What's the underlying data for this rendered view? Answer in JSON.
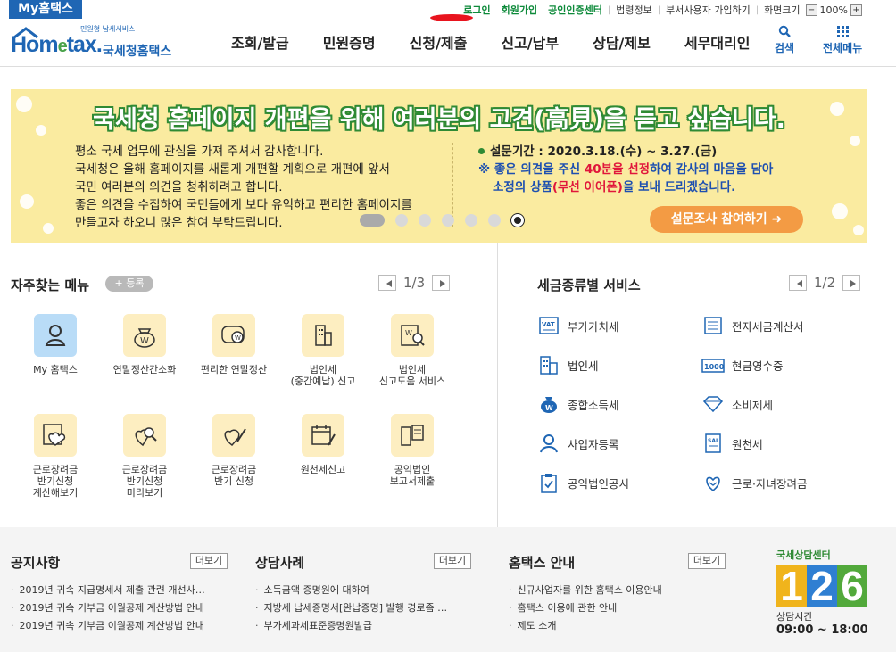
{
  "top": {
    "my_tab": "My홈택스",
    "links": [
      "로그인",
      "회원가입",
      "공인인증센터",
      "법령정보",
      "부서사용자 가입하기",
      "화면크기"
    ],
    "zoom_minus": "−",
    "zoom_value": "100%",
    "zoom_plus": "+"
  },
  "header": {
    "logo_sub": "민원형 납세서비스",
    "logo_main_a": "Hom",
    "logo_main_e": "e",
    "logo_main_b": "tax.",
    "logo_kr": "국세청홈택스",
    "nav": [
      "조회/발급",
      "민원증명",
      "신청/제출",
      "신고/납부",
      "상담/제보",
      "세무대리인"
    ],
    "search_label": "검색",
    "menu_label": "전체메뉴"
  },
  "banner": {
    "title": "국세청 홈페이지 개편을 위해 여러분의 고견(高見)을 듣고 싶습니다.",
    "lines": [
      "평소 국세 업무에 관심을 가져 주셔서 감사합니다.",
      "국세청은 올해 홈페이지를 새롭게 개편할 계획으로 개편에 앞서",
      "국민 여러분의 의견을 청취하려고 합니다.",
      "좋은 의견을 수집하여 국민들에게 보다 유익하고 편리한 홈페이지를",
      "만들고자 하오니 많은 참여 부탁드립니다."
    ],
    "period": "설문기간 : 2020.3.18.(수) ~ 3.27.(금)",
    "note_a": "※ 좋은 의견을 주신 ",
    "note_red1": "40분을 선정",
    "note_b": "하여 감사의 마음을 담아",
    "note_c": "소정의 상품",
    "note_red2": "(무선 이어폰)",
    "note_d": "을 보내 드리겠습니다.",
    "survey_button": "설문조사 참여하기 ➜"
  },
  "favorites": {
    "title": "자주찾는 메뉴",
    "register": "+ 등록",
    "page": "1/3",
    "items": [
      {
        "label": "My 홈택스"
      },
      {
        "label": "연말정산간소화"
      },
      {
        "label": "편리한 연말정산"
      },
      {
        "label": "법인세\n(중간예납) 신고"
      },
      {
        "label": "법인세\n신고도움 서비스"
      },
      {
        "label": "근로장려금\n반기신청\n계산해보기"
      },
      {
        "label": "근로장려금\n반기신청\n미리보기"
      },
      {
        "label": "근로장려금\n반기 신청"
      },
      {
        "label": "원천세신고"
      },
      {
        "label": "공익법인\n보고서제출"
      }
    ]
  },
  "tax_services": {
    "title": "세금종류별 서비스",
    "page": "1/2",
    "items": [
      "부가가치세",
      "전자세금계산서",
      "법인세",
      "현금영수증",
      "종합소득세",
      "소비제세",
      "사업자등록",
      "원천세",
      "공익법인공시",
      "근로·자녀장려금"
    ]
  },
  "notice": {
    "title": "공지사항",
    "more": "더보기",
    "items": [
      "2019년 귀속 지급명세서 제출 관련 개선사…",
      "2019년 귀속 기부금 이월공제 계산방법 안내",
      "2019년 귀속 기부금 이월공제 계산방법 안내"
    ]
  },
  "cases": {
    "title": "상담사례",
    "more": "더보기",
    "items": [
      "소득금액 증명원에 대하여",
      "지방세 납세증명서[완납증명] 발행 경로좀 …",
      "부가세과세표준증명원발급"
    ]
  },
  "guide": {
    "title": "홈택스 안내",
    "more": "더보기",
    "items": [
      "신규사업자를 위한 홈택스 이용안내",
      "홈택스 이용에 관한 안내",
      "제도 소개"
    ]
  },
  "center": {
    "label": "국세상담센터",
    "digits": [
      "1",
      "2",
      "6"
    ],
    "hours_label": "상담시간",
    "hours": "09:00 ~ 18:00"
  },
  "colors": {
    "brand": "#1f66b4",
    "green": "#2f8a34",
    "banner_bg": "#faeba0",
    "orange": "#f39b44"
  }
}
